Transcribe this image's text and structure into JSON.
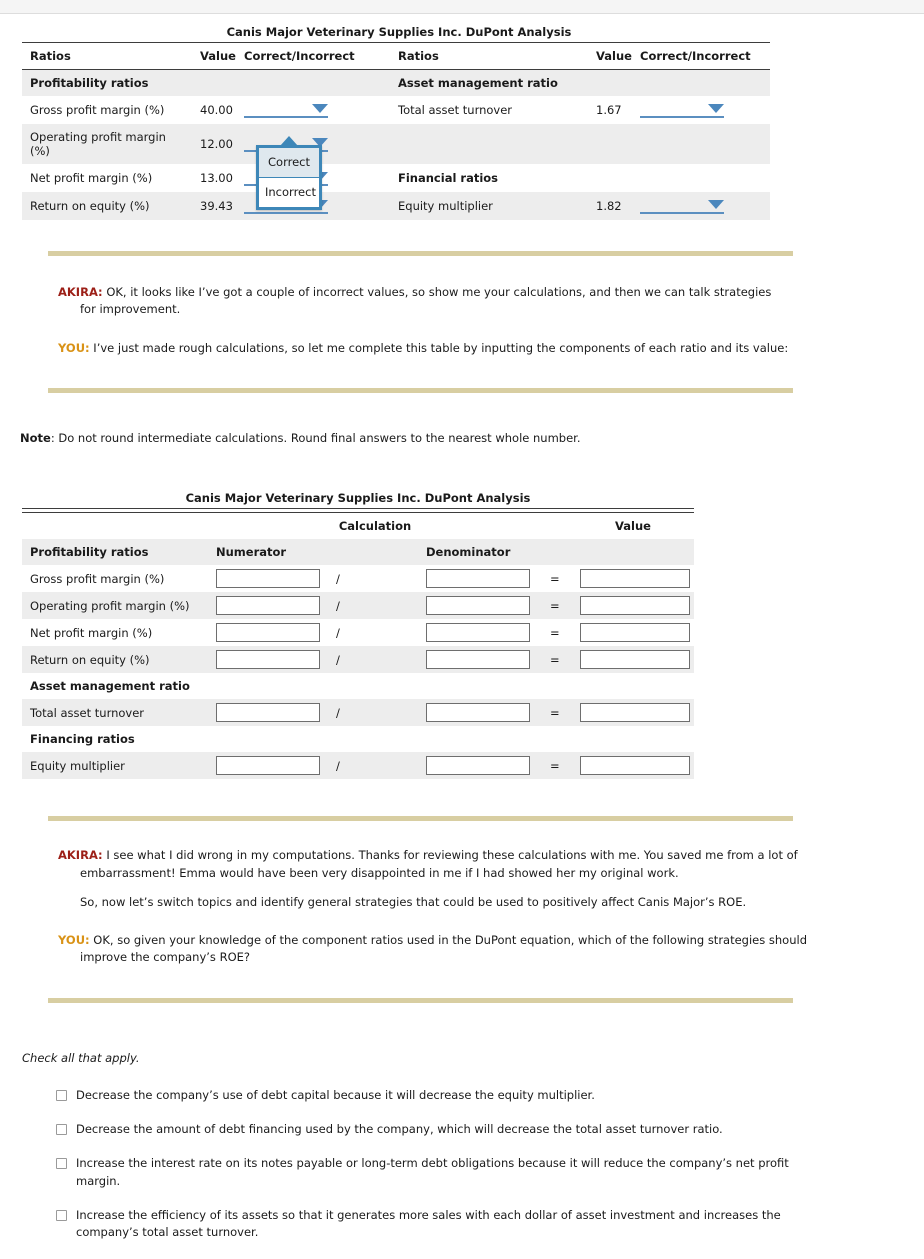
{
  "table1": {
    "title": "Canis Major Veterinary Supplies Inc. DuPont Analysis",
    "headers": [
      "Ratios",
      "Value",
      "Correct/Incorrect",
      "Ratios",
      "Value",
      "Correct/Incorrect"
    ],
    "rows": [
      {
        "left_label": "Profitability ratios",
        "left_value": "",
        "left_group": true,
        "right_label": "Asset management ratio",
        "right_value": "",
        "right_group": true,
        "shaded": true
      },
      {
        "left_label": "Gross profit margin (%)",
        "left_value": "40.00",
        "left_dropdown": true,
        "right_label": "Total asset turnover",
        "right_value": "1.67",
        "right_dropdown": true,
        "shaded": false
      },
      {
        "left_label": "Operating profit margin (%)",
        "left_value": "12.00",
        "left_dropdown": true,
        "right_label": "",
        "right_value": "",
        "right_dropdown": false,
        "shaded": true
      },
      {
        "left_label": "Net profit margin (%)",
        "left_value": "13.00",
        "left_dropdown": true,
        "right_label": "Financial ratios",
        "right_value": "",
        "right_group": true,
        "shaded": false
      },
      {
        "left_label": "Return on equity (%)",
        "left_value": "39.43",
        "left_dropdown": true,
        "right_label": "Equity multiplier",
        "right_value": "1.82",
        "right_dropdown": true,
        "shaded": true
      }
    ],
    "dropdown_popup": {
      "options": [
        "Correct",
        "Incorrect"
      ],
      "selected": "Correct"
    }
  },
  "dialogue1": [
    {
      "speaker": "AKIRA:",
      "speaker_type": "akira",
      "text": "OK, it looks like I’ve got a couple of incorrect values, so show me your calculations, and then we can talk strategies for improvement."
    },
    {
      "speaker": "YOU:",
      "speaker_type": "you",
      "text": "I’ve just made rough calculations, so let me complete this table by inputting the components of each ratio and its value:"
    }
  ],
  "note": {
    "label": "Note",
    "text": ": Do not round intermediate calculations. Round final answers to the nearest whole number."
  },
  "table2": {
    "title": "Canis Major Veterinary Supplies Inc. DuPont Analysis",
    "group_headers": {
      "calculation": "Calculation",
      "value": "Value"
    },
    "column_headers": {
      "ratios": "Profitability ratios",
      "numerator": "Numerator",
      "denominator": "Denominator"
    },
    "ops": {
      "divide": "/",
      "equals": "="
    },
    "rows": [
      {
        "label": "Gross profit margin (%)",
        "numerator": "",
        "denominator": "",
        "value": "",
        "shaded": false,
        "type": "input"
      },
      {
        "label": "Operating profit margin (%)",
        "numerator": "",
        "denominator": "",
        "value": "",
        "shaded": true,
        "type": "input"
      },
      {
        "label": "Net profit margin (%)",
        "numerator": "",
        "denominator": "",
        "value": "",
        "shaded": false,
        "type": "input"
      },
      {
        "label": "Return on equity (%)",
        "numerator": "",
        "denominator": "",
        "value": "",
        "shaded": true,
        "type": "input"
      },
      {
        "label": "Asset management ratio",
        "type": "group"
      },
      {
        "label": "Total asset turnover",
        "numerator": "",
        "denominator": "",
        "value": "",
        "shaded": true,
        "type": "input"
      },
      {
        "label": "Financing ratios",
        "type": "group"
      },
      {
        "label": "Equity multiplier",
        "numerator": "",
        "denominator": "",
        "value": "",
        "shaded": true,
        "type": "input"
      }
    ]
  },
  "dialogue2": [
    {
      "speaker": "AKIRA:",
      "speaker_type": "akira",
      "text": "I see what I did wrong in my computations. Thanks for reviewing these calculations with me. You saved me from a lot of embarrassment! Emma would have been very disappointed in me if I had showed her my original work."
    },
    {
      "speaker": "",
      "speaker_type": "cont",
      "text": "So, now let’s switch topics and identify general strategies that could be used to positively affect Canis Major’s ROE."
    },
    {
      "speaker": "YOU:",
      "speaker_type": "you",
      "text": "OK, so given your knowledge of the component ratios used in the DuPont equation, which of the following strategies should improve the company’s ROE?"
    }
  ],
  "checklist": {
    "instruction": "Check all that apply.",
    "options": [
      {
        "label": "Decrease the company’s use of debt capital because it will decrease the equity multiplier.",
        "checked": false
      },
      {
        "label": "Decrease the amount of debt financing used by the company, which will decrease the total asset turnover ratio.",
        "checked": false
      },
      {
        "label": "Increase the interest rate on its notes payable or long-term debt obligations because it will reduce the company’s net profit margin.",
        "checked": false
      },
      {
        "label": "Increase the efficiency of its assets so that it generates more sales with each dollar of asset investment and increases the company’s total asset turnover.",
        "checked": false
      }
    ]
  },
  "colors": {
    "divider": "#d8cea2",
    "akira": "#9c1f17",
    "you": "#d99216",
    "dropdown_blue": "#4b87bd",
    "popup_border": "#3d87b8",
    "row_shade": "#ededed"
  }
}
